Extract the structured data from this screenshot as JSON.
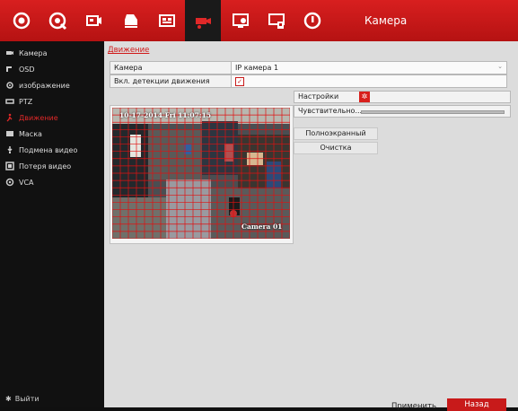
{
  "header": {
    "title": "Камера",
    "icons": [
      "live-view-icon",
      "playback-icon",
      "camera-mgmt-icon",
      "record-icon",
      "hdd-icon",
      "camera-settings-icon",
      "system-icon",
      "maintenance-icon",
      "shutdown-icon"
    ]
  },
  "sidebar": {
    "items": [
      {
        "label": "Камера",
        "icon": "camera-icon"
      },
      {
        "label": "OSD",
        "icon": "osd-icon"
      },
      {
        "label": "изображение",
        "icon": "image-icon"
      },
      {
        "label": "PTZ",
        "icon": "ptz-icon"
      },
      {
        "label": "Движение",
        "icon": "motion-icon",
        "active": true
      },
      {
        "label": "Маска",
        "icon": "mask-icon"
      },
      {
        "label": "Подмена видео",
        "icon": "tamper-icon"
      },
      {
        "label": "Потеря видео",
        "icon": "video-loss-icon"
      },
      {
        "label": "VCA",
        "icon": "vca-icon"
      }
    ],
    "logout_label": "Выйти"
  },
  "main": {
    "breadcrumb": "Движение",
    "camera_label": "Камера",
    "camera_value": "IP камера 1",
    "enable_label": "Вкл. детекции движения",
    "enable_checked": true,
    "video_osd_time": "10-17-2014 Fri 11:07:15",
    "video_osd_name": "Camera 01",
    "settings_label": "Настройки",
    "sensitivity_label": "Чувствительно...",
    "fullscreen_label": "Полноэкранный",
    "clear_label": "Очистка",
    "apply_label": "Применить",
    "back_label": "Назад"
  },
  "colors": {
    "accent": "#d01818",
    "grid": "#e01010"
  }
}
